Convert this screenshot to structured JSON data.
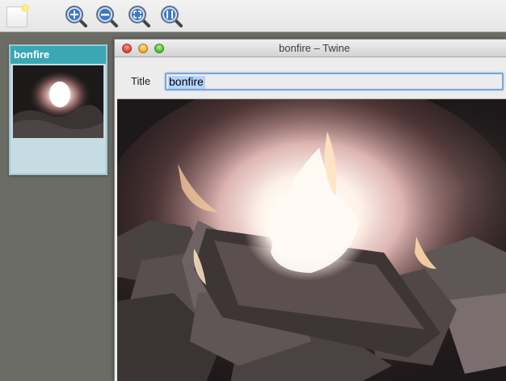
{
  "toolbar": {
    "buttons": [
      {
        "name": "new-passage-button",
        "icon": "new-document-icon"
      },
      {
        "name": "zoom-in-button",
        "icon": "zoom-in-icon"
      },
      {
        "name": "zoom-out-button",
        "icon": "zoom-out-icon"
      },
      {
        "name": "zoom-fit-button",
        "icon": "zoom-fit-icon"
      },
      {
        "name": "zoom-actual-button",
        "icon": "zoom-actual-size-icon"
      }
    ]
  },
  "storymap": {
    "passages": [
      {
        "title": "bonfire",
        "thumbnail": "bonfire-photo"
      }
    ]
  },
  "editor": {
    "window_title": "bonfire – Twine",
    "title_label": "Title",
    "title_value": "bonfire",
    "content_image": "bonfire-photo"
  },
  "colors": {
    "card_header": "#3aa7b5",
    "card_body": "#c6dbe2",
    "background": "#6b6c66",
    "input_focus": "#7aa6dc"
  }
}
